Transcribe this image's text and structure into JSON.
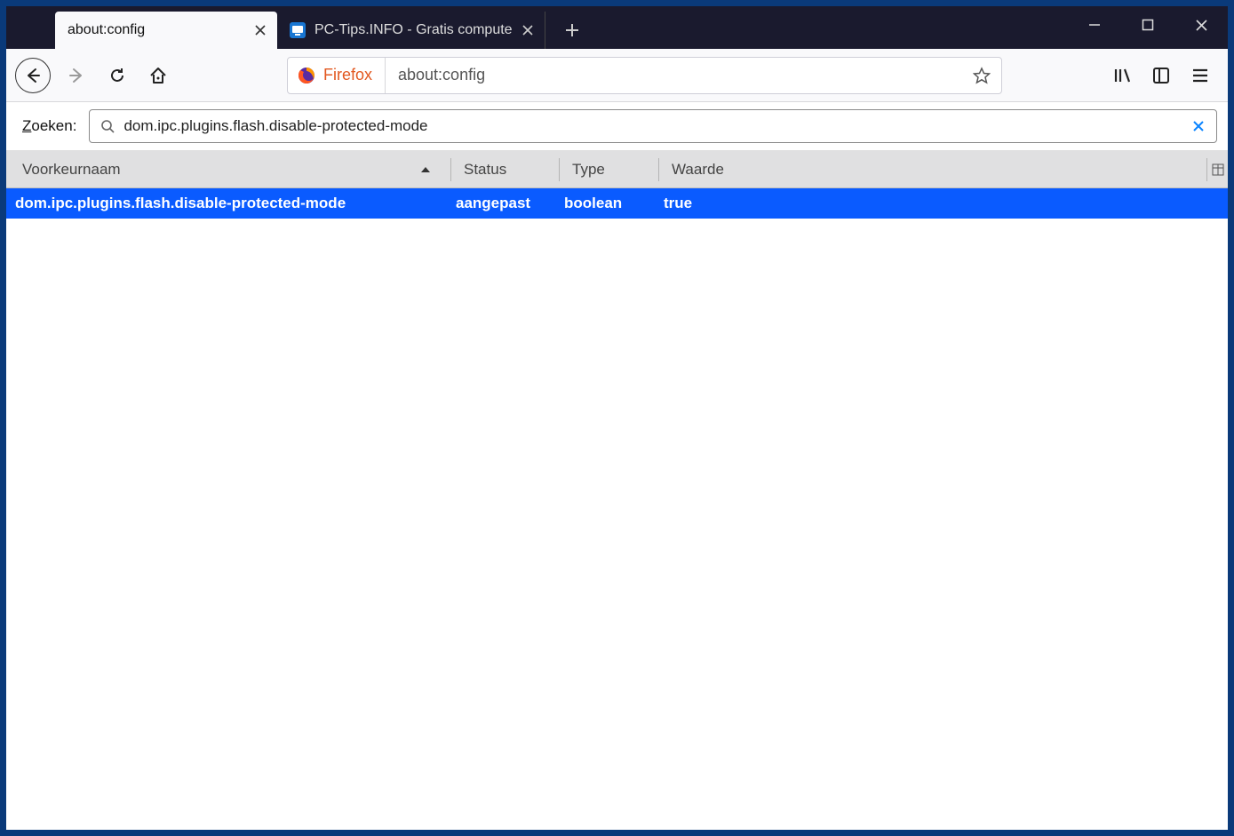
{
  "tabs": [
    {
      "title": "about:config"
    },
    {
      "title": "PC-Tips.INFO - Gratis compute"
    }
  ],
  "url_bar": {
    "identity_label": "Firefox",
    "url": "about:config"
  },
  "search": {
    "label_prefix": "Z",
    "label_rest": "oeken:",
    "value": "dom.ipc.plugins.flash.disable-protected-mode"
  },
  "columns": {
    "name": "Voorkeurnaam",
    "status": "Status",
    "type": "Type",
    "value": "Waarde"
  },
  "row": {
    "name": "dom.ipc.plugins.flash.disable-protected-mode",
    "status": "aangepast",
    "type": "boolean",
    "value": "true"
  }
}
